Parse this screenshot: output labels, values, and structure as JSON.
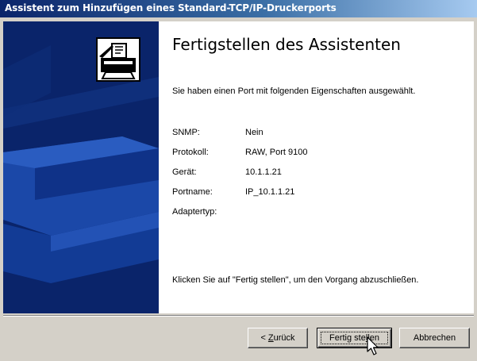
{
  "window": {
    "title": "Assistent zum Hinzufügen eines Standard-TCP/IP-Druckerports"
  },
  "main": {
    "heading": "Fertigstellen des Assistenten",
    "intro": "Sie haben einen Port mit folgenden Eigenschaften ausgewählt.",
    "properties": [
      {
        "label": "SNMP:",
        "value": "Nein"
      },
      {
        "label": "Protokoll:",
        "value": "RAW, Port 9100"
      },
      {
        "label": "Gerät:",
        "value": "10.1.1.21"
      },
      {
        "label": "Portname:",
        "value": "IP_10.1.1.21"
      },
      {
        "label": "Adaptertyp:",
        "value": ""
      }
    ],
    "finish_text": "Klicken Sie auf \"Fertig stellen\", um den Vorgang abzuschließen."
  },
  "buttons": {
    "back": {
      "prefix": "< ",
      "mnemonic": "Z",
      "rest": "urück"
    },
    "finish": {
      "prefix": "Fertig ste",
      "mnemonic": "l",
      "rest": "len"
    },
    "cancel": "Abbrechen"
  },
  "icons": {
    "sidebar": "printer-icon",
    "cursor": "arrow-cursor-icon"
  },
  "colors": {
    "title_bar_start": "#0a246a",
    "title_bar_end": "#a6caf0",
    "side_panel": "#0a246a",
    "dialog_face": "#d4d0c8"
  }
}
